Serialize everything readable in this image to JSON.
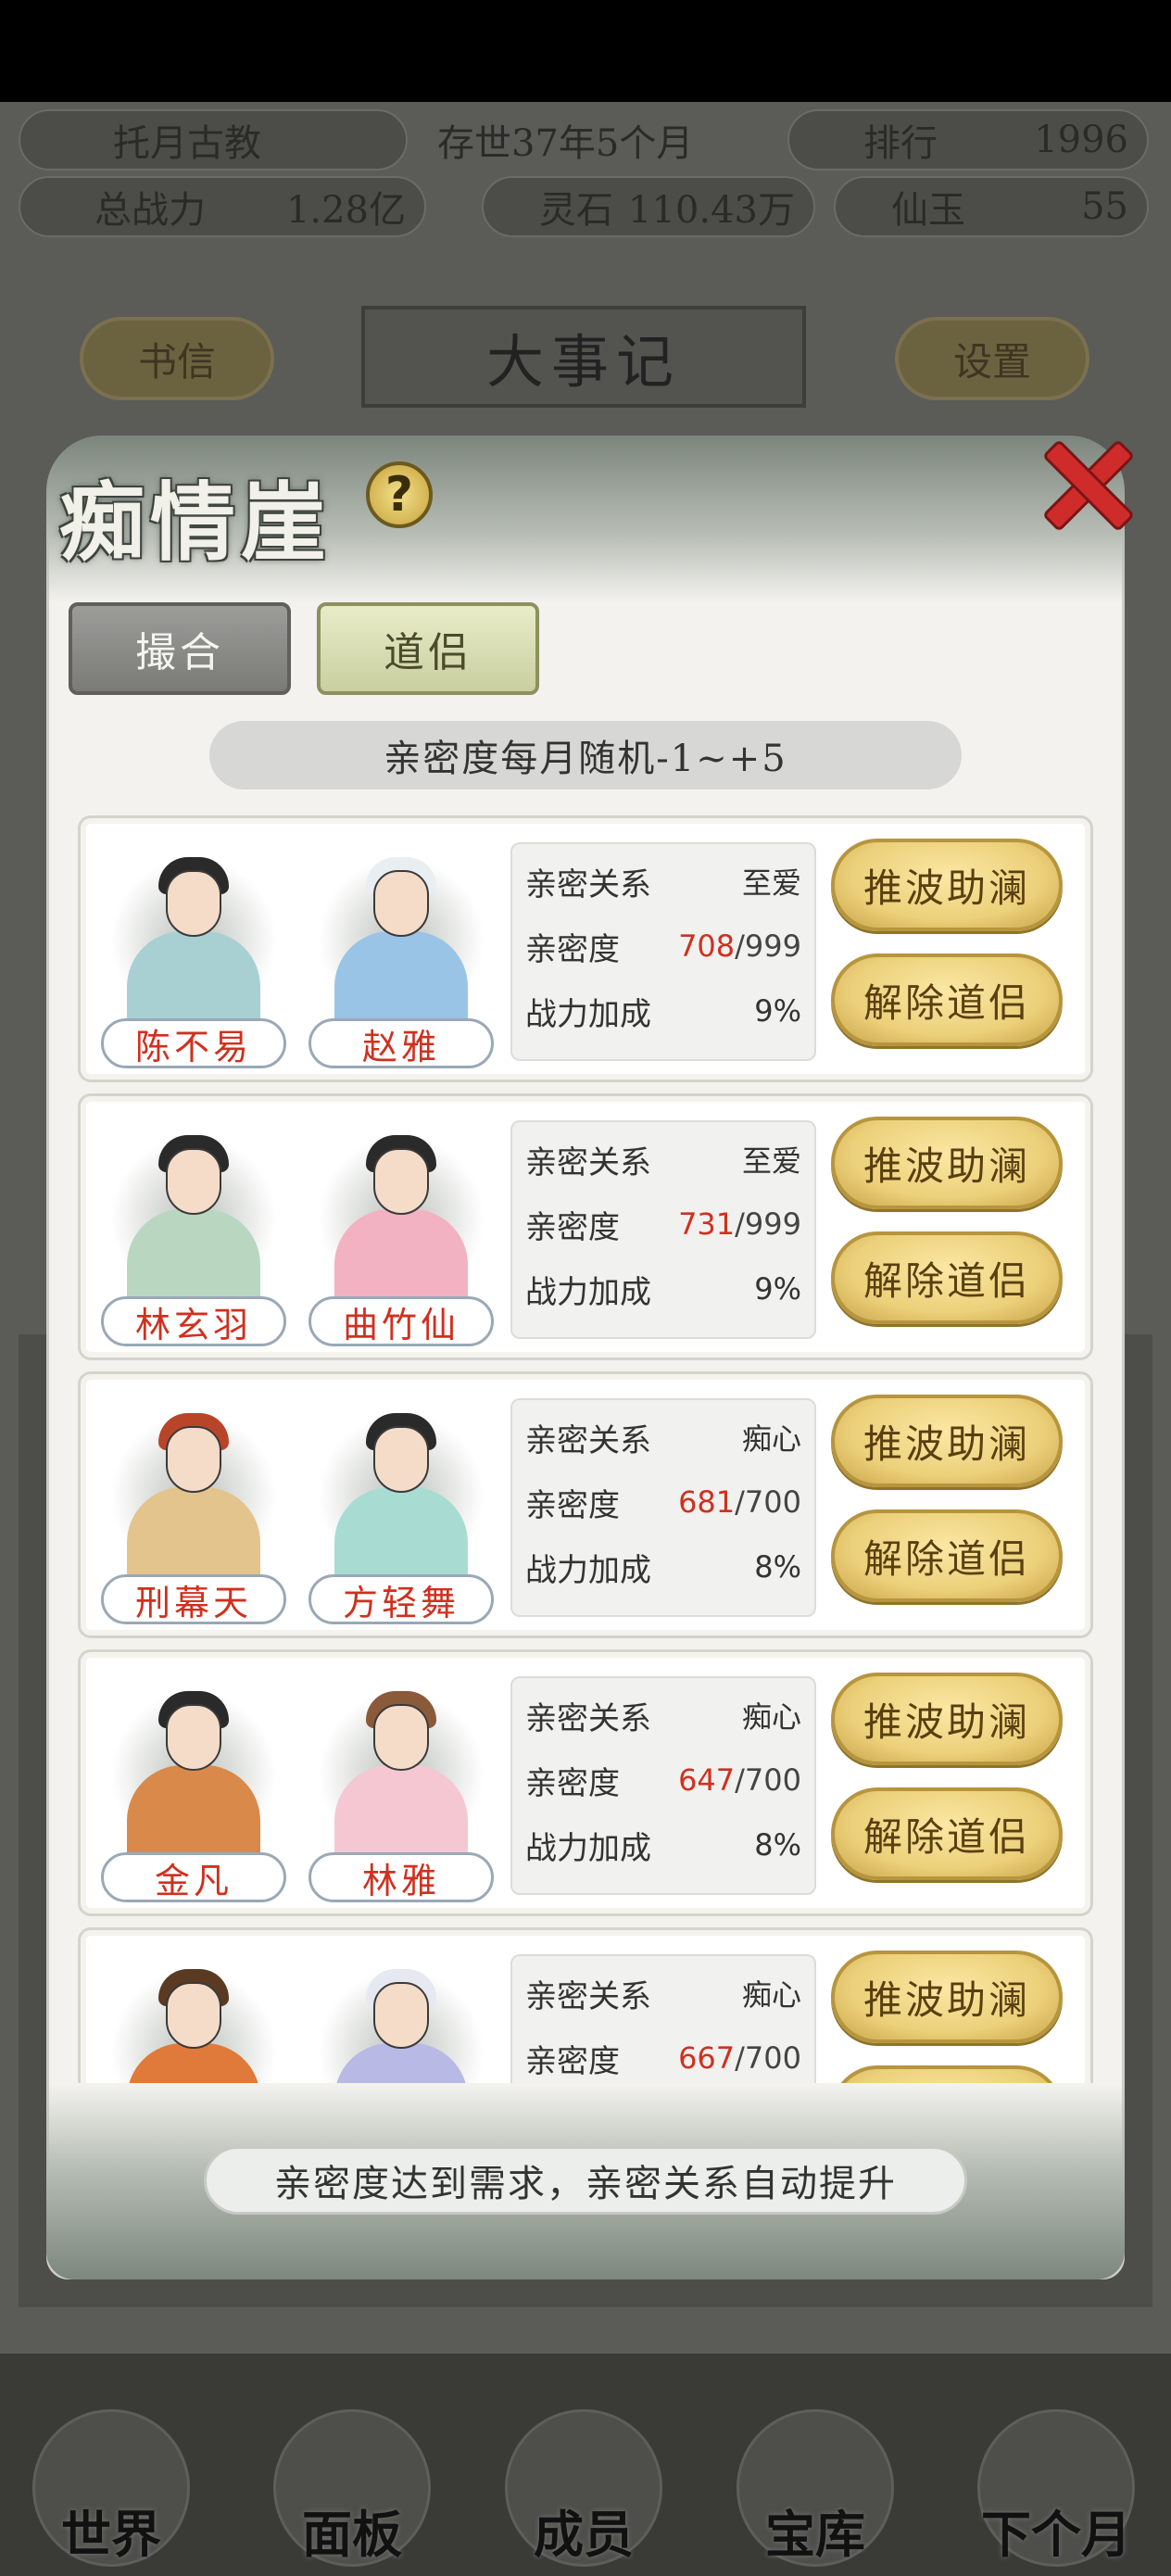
{
  "background": {
    "sect_name": "托月古教",
    "age": "存世37年5个月",
    "rank_label": "排行",
    "rank_value": "1996",
    "power_label": "总战力",
    "power_value": "1.28亿",
    "stone_label": "灵石",
    "stone_value": "110.43万",
    "jade_label": "仙玉",
    "jade_value": "55",
    "btn_letters": "书信",
    "title": "大事记",
    "btn_settings": "设置",
    "nav": [
      {
        "label": "世界"
      },
      {
        "label": "面板"
      },
      {
        "label": "成员"
      },
      {
        "label": "宝库"
      },
      {
        "label": "下个月"
      }
    ]
  },
  "modal": {
    "title": "痴情崖",
    "help_symbol": "?",
    "tabs": [
      {
        "label": "撮合",
        "active": false
      },
      {
        "label": "道侣",
        "active": true
      }
    ],
    "info": "亲密度每月随机-1~+5",
    "footer": "亲密度达到需求，亲密关系自动提升",
    "row_labels": {
      "relation": "亲密关系",
      "intimacy": "亲密度",
      "bonus": "战力加成"
    },
    "buttons": {
      "boost": "推波助澜",
      "dissolve": "解除道侣"
    },
    "couples": [
      {
        "male": "陈不易",
        "female": "赵雅",
        "relation": "至爱",
        "intimacy": "708",
        "intimacy_max": "/999",
        "bonus": "9%"
      },
      {
        "male": "林玄羽",
        "female": "曲竹仙",
        "relation": "至爱",
        "intimacy": "731",
        "intimacy_max": "/999",
        "bonus": "9%"
      },
      {
        "male": "刑幕天",
        "female": "方轻舞",
        "relation": "痴心",
        "intimacy": "681",
        "intimacy_max": "/700",
        "bonus": "8%"
      },
      {
        "male": "金凡",
        "female": "林雅",
        "relation": "痴心",
        "intimacy": "647",
        "intimacy_max": "/700",
        "bonus": "8%"
      },
      {
        "male": "",
        "female": "",
        "relation": "痴心",
        "intimacy": "667",
        "intimacy_max": "/700",
        "bonus": ""
      }
    ]
  },
  "colors": {
    "accent_red": "#d0301f",
    "gold_button": "#ecd07a",
    "active_tab": "#c9cf9f"
  }
}
